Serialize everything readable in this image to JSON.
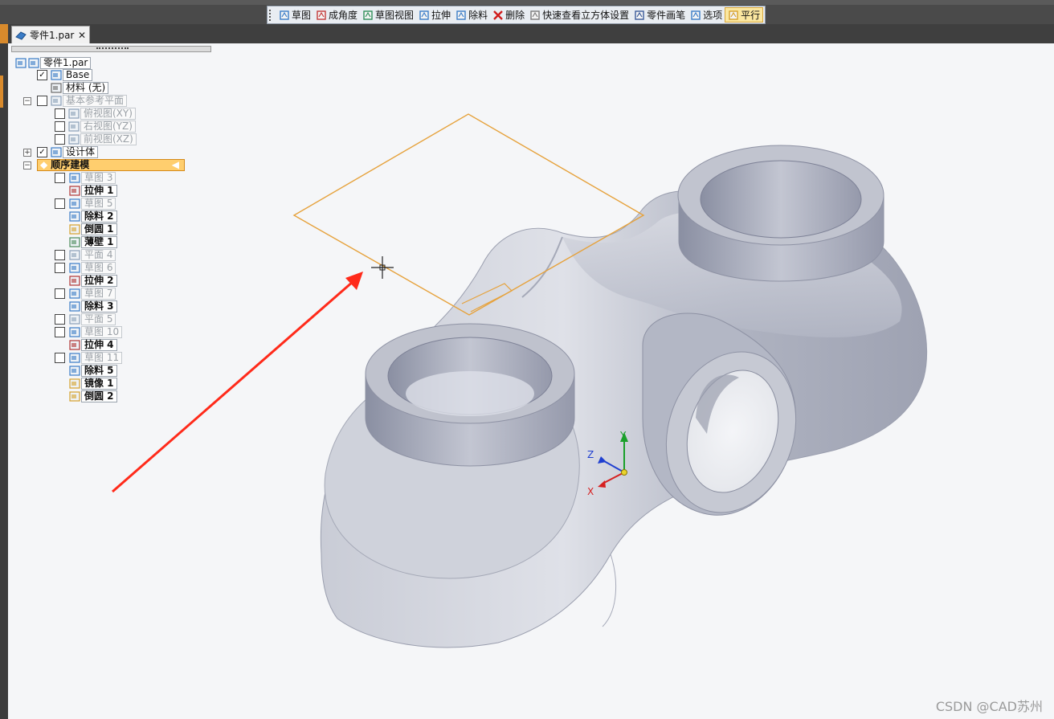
{
  "quick_toolbar": {
    "items": [
      {
        "label": "草图",
        "icon": "sketch-icon"
      },
      {
        "label": "成角度",
        "icon": "angled-icon"
      },
      {
        "label": "草图视图",
        "icon": "sketch-view-icon"
      },
      {
        "label": "拉伸",
        "icon": "extrude-icon"
      },
      {
        "label": "除料",
        "icon": "cut-icon"
      },
      {
        "label": "删除",
        "icon": "delete-icon"
      },
      {
        "label": "快速查看立方体设置",
        "icon": "view-cube-icon"
      },
      {
        "label": "零件画笔",
        "icon": "part-painter-icon"
      },
      {
        "label": "选项",
        "icon": "options-icon"
      },
      {
        "label": "平行",
        "icon": "parallel-icon"
      }
    ]
  },
  "document_tab": {
    "title": "零件1.par",
    "close": "✕"
  },
  "tree": {
    "root": "零件1.par",
    "base": "Base",
    "material": "材料 (无)",
    "ref_planes": "基本参考平面",
    "planes": [
      "俯视图(XY)",
      "右视图(YZ)",
      "前视图(XZ)"
    ],
    "design_body": "设计体",
    "ordered": "顺序建模",
    "features": [
      {
        "label": "草图 3",
        "style": "gray",
        "checkbox": true
      },
      {
        "label": "拉伸 1",
        "style": "bold",
        "checkbox": false
      },
      {
        "label": "草图 5",
        "style": "gray",
        "checkbox": true
      },
      {
        "label": "除料 2",
        "style": "bold",
        "checkbox": false
      },
      {
        "label": "倒圆 1",
        "style": "bold",
        "checkbox": false
      },
      {
        "label": "薄壁 1",
        "style": "bold",
        "checkbox": false
      },
      {
        "label": "平面 4",
        "style": "gray",
        "checkbox": true
      },
      {
        "label": "草图 6",
        "style": "gray",
        "checkbox": true
      },
      {
        "label": "拉伸 2",
        "style": "bold",
        "checkbox": false
      },
      {
        "label": "草图 7",
        "style": "gray",
        "checkbox": true
      },
      {
        "label": "除料 3",
        "style": "bold",
        "checkbox": false
      },
      {
        "label": "平面 5",
        "style": "gray",
        "checkbox": true
      },
      {
        "label": "草图 10",
        "style": "gray",
        "checkbox": true
      },
      {
        "label": "拉伸 4",
        "style": "bold",
        "checkbox": false
      },
      {
        "label": "草图 11",
        "style": "gray",
        "checkbox": true
      },
      {
        "label": "除料 5",
        "style": "bold",
        "checkbox": false
      },
      {
        "label": "镜像 1",
        "style": "bold",
        "checkbox": false
      },
      {
        "label": "倒圆 2",
        "style": "bold",
        "checkbox": false
      }
    ]
  },
  "triad": {
    "x": "X",
    "y": "Y",
    "z": "Z"
  },
  "watermark": "CSDN @CAD苏州",
  "colors": {
    "plane_outline": "#e6a23c",
    "arrow": "#ff2a1a",
    "part": "#b9bdc9",
    "selection": "#ffce6e"
  }
}
